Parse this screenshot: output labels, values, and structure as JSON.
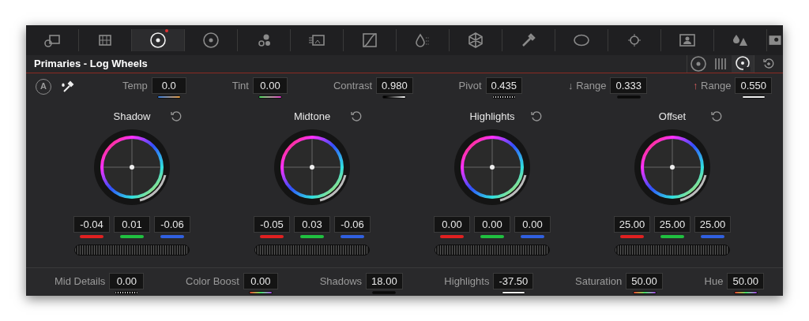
{
  "toolbar": [
    {
      "selected": false,
      "badge": false
    },
    {
      "selected": false,
      "badge": false
    },
    {
      "selected": true,
      "badge": true
    },
    {
      "selected": false,
      "badge": false
    },
    {
      "selected": false,
      "badge": false
    },
    {
      "selected": false,
      "badge": false
    },
    {
      "selected": false,
      "badge": false
    },
    {
      "selected": false,
      "badge": false
    },
    {
      "selected": false,
      "badge": false
    },
    {
      "selected": false,
      "badge": false
    },
    {
      "selected": false,
      "badge": false
    },
    {
      "selected": false,
      "badge": false
    },
    {
      "selected": false,
      "badge": false
    },
    {
      "selected": false,
      "badge": false
    }
  ],
  "panel": {
    "title": "Primaries - Log Wheels",
    "modes": [
      {
        "selected": false
      },
      {
        "selected": false
      },
      {
        "selected": true
      }
    ]
  },
  "auto_button": "A",
  "parameters": [
    {
      "label": "Temp",
      "value": "0.0",
      "kind": "blue-orange"
    },
    {
      "label": "Tint",
      "value": "0.00",
      "kind": "green-magenta"
    },
    {
      "label": "Contrast",
      "value": "0.980",
      "kind": "black-white"
    },
    {
      "label": "Pivot",
      "value": "0.435",
      "kind": "dotted"
    },
    {
      "arrow": "↓",
      "label": "Range",
      "value": "0.333",
      "kind": "dark"
    },
    {
      "arrow": "↑",
      "label": "Range",
      "value": "0.550",
      "kind": "white"
    }
  ],
  "wheels": [
    {
      "title": "Shadow",
      "values": [
        "-0.04",
        "0.01",
        "-0.06"
      ]
    },
    {
      "title": "Midtone",
      "values": [
        "-0.05",
        "0.03",
        "-0.06"
      ]
    },
    {
      "title": "Highlights",
      "values": [
        "0.00",
        "0.00",
        "0.00"
      ]
    },
    {
      "title": "Offset",
      "values": [
        "25.00",
        "25.00",
        "25.00"
      ]
    }
  ],
  "bottom": [
    {
      "label": "Mid Details",
      "value": "0.00",
      "kind": "dotted"
    },
    {
      "label": "Color Boost",
      "value": "0.00",
      "kind": "rainbow"
    },
    {
      "label": "Shadows",
      "value": "18.00",
      "kind": "dark"
    },
    {
      "label": "Highlights",
      "value": "-37.50",
      "kind": "white"
    },
    {
      "label": "Saturation",
      "value": "50.00",
      "kind": "rainbow"
    },
    {
      "label": "Hue",
      "value": "50.00",
      "kind": "rainbow"
    }
  ]
}
